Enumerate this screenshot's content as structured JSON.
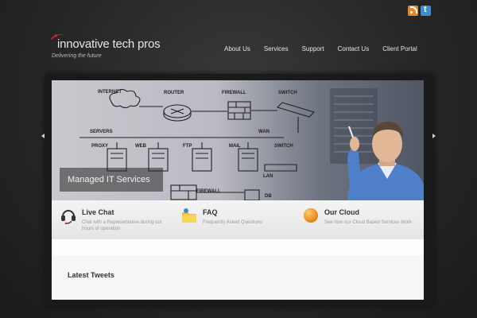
{
  "brand": {
    "name": "innovative tech pros",
    "tagline": "Delivering the future",
    "accent": "#d22a2a"
  },
  "social": [
    {
      "icon": "rss-icon"
    },
    {
      "icon": "twitter-icon"
    }
  ],
  "nav": {
    "items": [
      "About Us",
      "Services",
      "Support",
      "Contact Us",
      "Client Portal"
    ]
  },
  "slider": {
    "caption": "Managed IT Services",
    "diagram_labels": {
      "internet": "INTERNET",
      "router": "ROUTER",
      "firewall_top": "FIREWALL",
      "switch_top": "SWITCH",
      "servers": "SERVERS",
      "wan": "WAN",
      "proxy": "PROXY",
      "web": "WEB",
      "ftp": "FTP",
      "mail": "MAIL",
      "switch_mid": "SWITCH",
      "lan": "LAN",
      "firewall_bottom": "FIREWALL",
      "db": "DB"
    }
  },
  "features": [
    {
      "title": "Live Chat",
      "desc": "Chat with a Representative during our hours of operation",
      "icon": "headset-icon"
    },
    {
      "title": "FAQ",
      "desc": "Frequently Asked Questions",
      "icon": "folder-icon"
    },
    {
      "title": "Our Cloud",
      "desc": "See how our Cloud Based Services Work",
      "icon": "cloud-icon"
    }
  ],
  "tweets": {
    "title": "Latest Tweets"
  }
}
